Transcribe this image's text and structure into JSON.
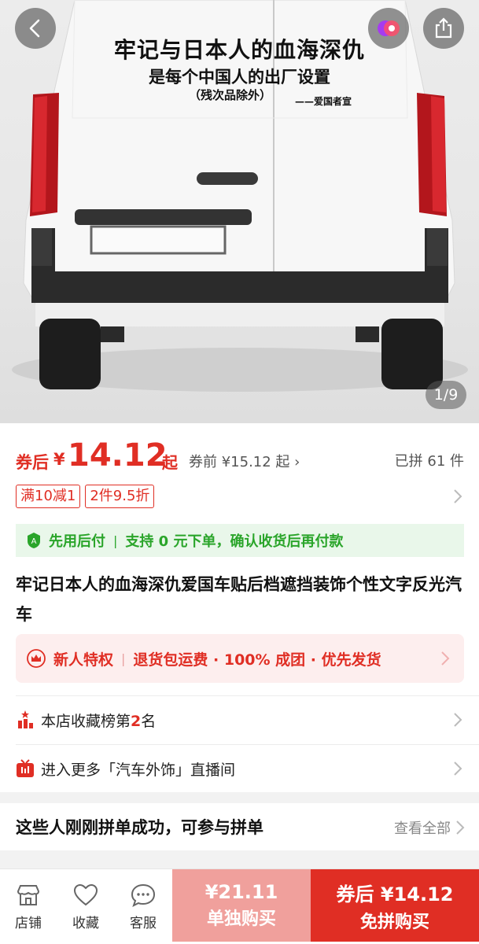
{
  "hero": {
    "decal_line1": "牢记与日本人的血海深仇",
    "decal_line2": "是每个中国人的出厂设置",
    "decal_line3": "（残次品除外）",
    "decal_signature": "——爱国者宣",
    "image_counter": "1/9"
  },
  "price": {
    "after_coupon_label": "券后",
    "currency": "¥",
    "amount": "14.12",
    "qi": "起",
    "before_coupon": "券前 ¥15.12 起",
    "sold": "已拼 61 件"
  },
  "tags": [
    "满10减1",
    "2件9.5折"
  ],
  "pay_later": {
    "label": "先用后付",
    "detail": "支持 0 元下单，确认收货后再付款"
  },
  "product_title": "牢记日本人的血海深仇爱国车贴后档遮挡装饰个性文字反光汽车",
  "promo": {
    "label": "新人特权",
    "detail": "退货包运费 · 100% 成团 · 优先发货"
  },
  "rank": {
    "prefix": "本店收藏榜第",
    "number": "2",
    "suffix": "名"
  },
  "live": {
    "text": "进入更多「汽车外饰」直播间"
  },
  "group_buy": {
    "title": "这些人刚刚拼单成功，可参与拼单",
    "view_all": "查看全部"
  },
  "bottom_bar": {
    "store": "店铺",
    "favorite": "收藏",
    "service": "客服",
    "solo_price": "¥21.11",
    "solo_label": "单独购买",
    "group_price": "券后 ¥14.12",
    "group_label": "免拼购买"
  },
  "colors": {
    "accent": "#e02e24",
    "green": "#2aa52a",
    "solo_bg": "#f0a09c"
  }
}
